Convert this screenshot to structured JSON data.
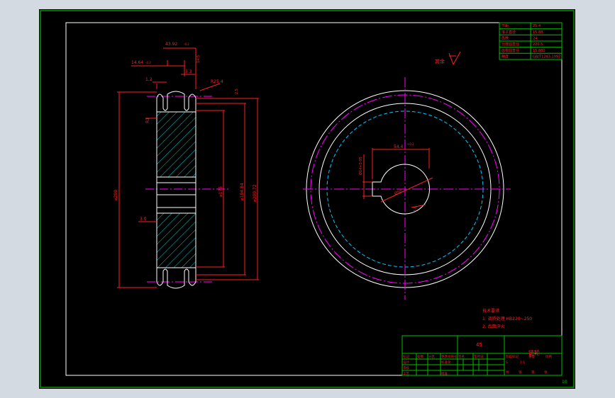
{
  "colors": {
    "background": "#000000",
    "viewport": "#d3dae1",
    "sheet_border": "#00c000",
    "frame": "#ffffff",
    "dimension": "#ff2020",
    "centerline": "#ff00ff",
    "hatch": "#00c8c8",
    "pitch_circle": "#00c8ff",
    "outline": "#ffffff"
  },
  "side_view": {
    "dims": {
      "top_width": "43.92",
      "top_width_tol": "-0.2",
      "tooth_width": "14.64",
      "tooth_width_tol": "-0.2",
      "chamfer_left": "1.2",
      "chamfer_right": "3.3",
      "radius": "R25.4",
      "outer_dia": "⌀209.72",
      "root_dia": "⌀194.84",
      "hub_dia": "⌀175",
      "body_dia": "⌀200",
      "offset": "3.0",
      "small_r": "R1",
      "angle": "2.5",
      "top_angle": "14.5"
    }
  },
  "front_view": {
    "dims": {
      "keyway_width": "54.4",
      "keyway_tol": "+0.2",
      "bore_height": "Ø14+0.05",
      "bore_dia": "Ø50",
      "roughness": "1.6"
    },
    "roughness_note": "其余"
  },
  "param_table": {
    "rows": [
      {
        "label": "节距",
        "value": "25.4"
      },
      {
        "label": "滚子直径",
        "value": "15.88"
      },
      {
        "label": "齿数",
        "value": "24"
      },
      {
        "label": "分度圆直径",
        "value": "220.5"
      },
      {
        "label": "齿根圆直径",
        "value": "15.880"
      },
      {
        "label": "精度",
        "value": "GB/T1243-1997"
      }
    ]
  },
  "tech_req": {
    "title": "技术要求",
    "lines": [
      "1. 调质处理 HB220~250",
      "2. 齿面淬火"
    ]
  },
  "title_block": {
    "part_name": "链轮",
    "center_label": "45",
    "rows": [
      [
        "标记",
        "处数",
        "分区",
        "更改文件号",
        "签名",
        "年月日"
      ],
      [
        "设计",
        "",
        "",
        "标准化",
        "",
        ""
      ],
      [
        "审核",
        "",
        "",
        "",
        "",
        ""
      ],
      [
        "工艺",
        "",
        "",
        "批准",
        "",
        ""
      ]
    ],
    "scale_cells": [
      "阶段标记",
      "重量",
      "比例",
      "S",
      "1:1",
      "共",
      "张",
      "第",
      "张"
    ]
  },
  "sheet_number": "10"
}
